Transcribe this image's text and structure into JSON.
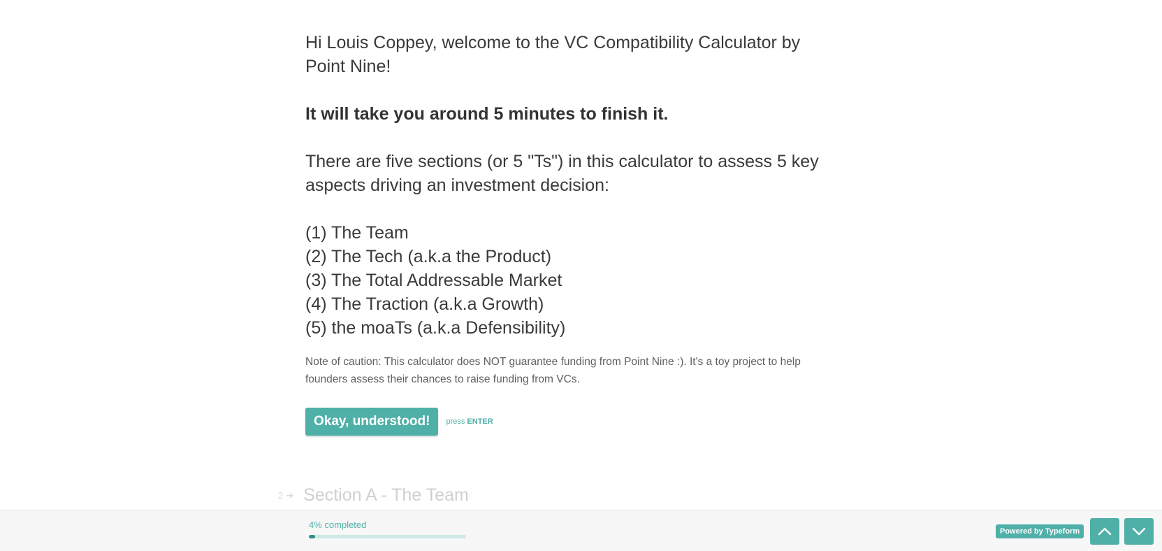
{
  "intro": {
    "welcome": "Hi Louis Coppey, welcome to the VC Compatibility Calculator by Point Nine!",
    "duration": "It will take you around 5 minutes to finish it.",
    "sections_intro": "There are five sections (or 5 \"Ts\") in this calculator to assess 5 key aspects driving an investment decision:",
    "sections": [
      "(1) The Team",
      "(2) The Tech (a.k.a the Product)",
      "(3) The Total Addressable Market",
      "(4) The Traction (a.k.a Growth)",
      "(5) the moaTs (a.k.a Defensibility)"
    ],
    "caution": "Note of caution: This calculator does NOT guarantee funding from Point Nine :). It's a toy project to help founders assess their chances to raise funding from VCs.",
    "button_label": "Okay, understood!",
    "press_label": "press",
    "enter_label": "ENTER"
  },
  "next_question": {
    "number": "2",
    "arrow": "➔",
    "title": "Section A - The Team"
  },
  "footer": {
    "progress_text": "4% completed",
    "progress_fraction": 0.04,
    "powered_prefix": "Powered by",
    "powered_brand": "Typeform",
    "up_icon": "chevron-up-icon",
    "down_icon": "chevron-down-icon"
  },
  "colors": {
    "accent": "#4fb0a8",
    "progress_fill": "#2f8f87"
  }
}
